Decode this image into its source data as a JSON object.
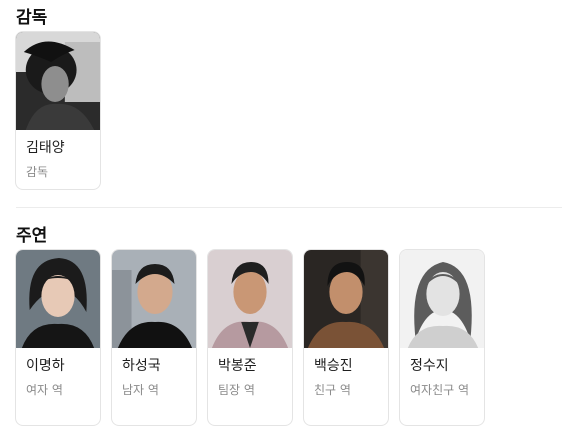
{
  "director_section": {
    "title": "감독",
    "people": [
      {
        "name": "김태양",
        "role": "감독",
        "photo_style": "bw-male-director"
      }
    ]
  },
  "cast_section": {
    "title": "주연",
    "people": [
      {
        "name": "이명하",
        "role": "여자 역",
        "photo_style": "female-dark-bob"
      },
      {
        "name": "하성국",
        "role": "남자 역",
        "photo_style": "male-short-dark-shirt"
      },
      {
        "name": "박봉준",
        "role": "팀장 역",
        "photo_style": "male-pink-bg"
      },
      {
        "name": "백승진",
        "role": "친구 역",
        "photo_style": "male-brown-shirt"
      },
      {
        "name": "정수지",
        "role": "여자친구 역",
        "photo_style": "bw-female-long-hair"
      }
    ]
  }
}
